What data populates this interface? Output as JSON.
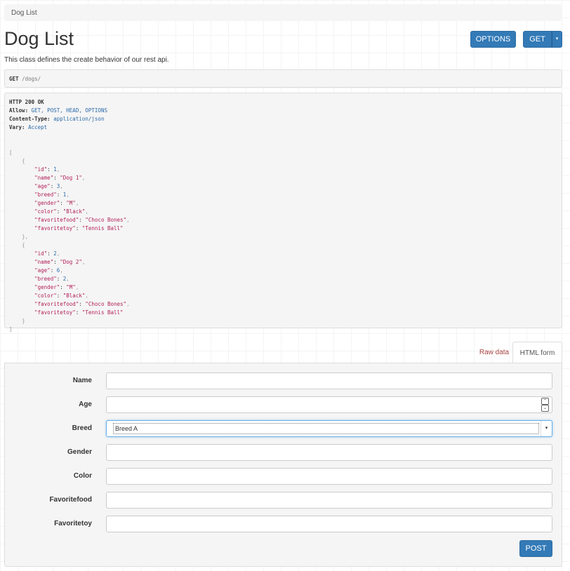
{
  "breadcrumb": "Dog List",
  "title": "Dog List",
  "description": "This class defines the create behavior of our rest api.",
  "buttons": {
    "options": "OPTIONS",
    "get": "GET",
    "caret": "▾",
    "post": "POST"
  },
  "request": {
    "method": "GET",
    "path": "/dogs/"
  },
  "response": {
    "status": "HTTP 200 OK",
    "headers": [
      {
        "name": "Allow:",
        "value": "GET, POST, HEAD, OPTIONS"
      },
      {
        "name": "Content-Type:",
        "value": "application/json"
      },
      {
        "name": "Vary:",
        "value": "Accept"
      }
    ],
    "items": [
      {
        "id": 1,
        "name": "Dog 1",
        "age": 3,
        "breed": 1,
        "gender": "M",
        "color": "Black",
        "favoritefood": "Choco Bones",
        "favoritetoy": "Tennis Ball"
      },
      {
        "id": 2,
        "name": "Dog 2",
        "age": 6,
        "breed": 2,
        "gender": "M",
        "color": "Black",
        "favoritefood": "Choco Bones",
        "favoritetoy": "Tennis Ball"
      }
    ]
  },
  "tabs": {
    "raw": "Raw data",
    "html": "HTML form"
  },
  "form": {
    "fields": [
      {
        "label": "Name",
        "value": ""
      },
      {
        "label": "Age",
        "value": ""
      },
      {
        "label": "Breed",
        "value": "Breed A"
      },
      {
        "label": "Gender",
        "value": ""
      },
      {
        "label": "Color",
        "value": ""
      },
      {
        "label": "Favoritefood",
        "value": ""
      },
      {
        "label": "Favoritetoy",
        "value": ""
      }
    ]
  },
  "colors": {
    "primary": "#337ab7",
    "raw_tab": "#a94442",
    "key": "#b22058",
    "number": "#2a6aa8"
  }
}
